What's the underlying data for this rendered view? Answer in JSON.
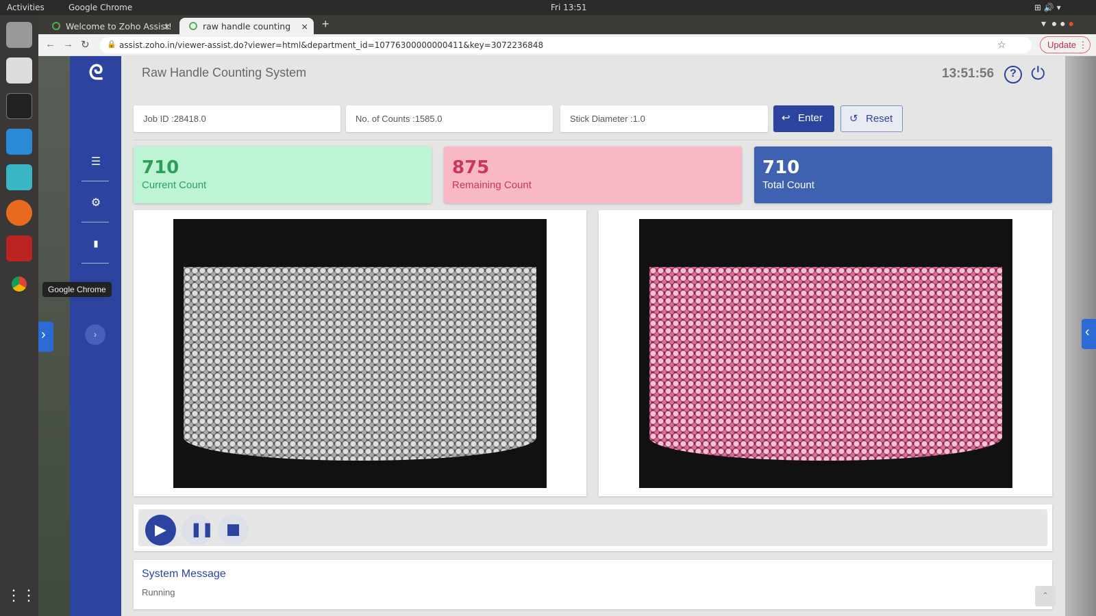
{
  "os": {
    "activities": "Activities",
    "app_menu": "Google Chrome",
    "clock": "Fri 13:51",
    "dock_tooltip": "Google Chrome"
  },
  "browser": {
    "tabs": [
      {
        "label": "Welcome to Zoho Assist!"
      },
      {
        "label": "raw handle counting",
        "active": true
      }
    ],
    "url": "assist.zoho.in/viewer-assist.do?viewer=html&department_id=10776300000000411&key=3072236848",
    "update_label": "Update"
  },
  "app": {
    "title": "Raw Handle Counting System",
    "time": "13:51:56",
    "accent": "#2c44a0",
    "fields": {
      "job_id": "Job ID :28418.0",
      "counts": "No. of Counts :1585.0",
      "diameter": "Stick Diameter :1.0"
    },
    "enter_label": "Enter",
    "reset_label": "Reset",
    "cards": [
      {
        "value": "710",
        "label": "Current Count",
        "color": "#2e9e5b",
        "bg": "#bdf5d4"
      },
      {
        "value": "875",
        "label": "Remaining Count",
        "color": "#c9365f",
        "bg": "#f8b8c6"
      },
      {
        "value": "710",
        "label": "Total Count",
        "color": "#ffffff",
        "bg": "#3f62b0"
      }
    ],
    "system_message": {
      "title": "System Message",
      "text": "Running"
    }
  }
}
